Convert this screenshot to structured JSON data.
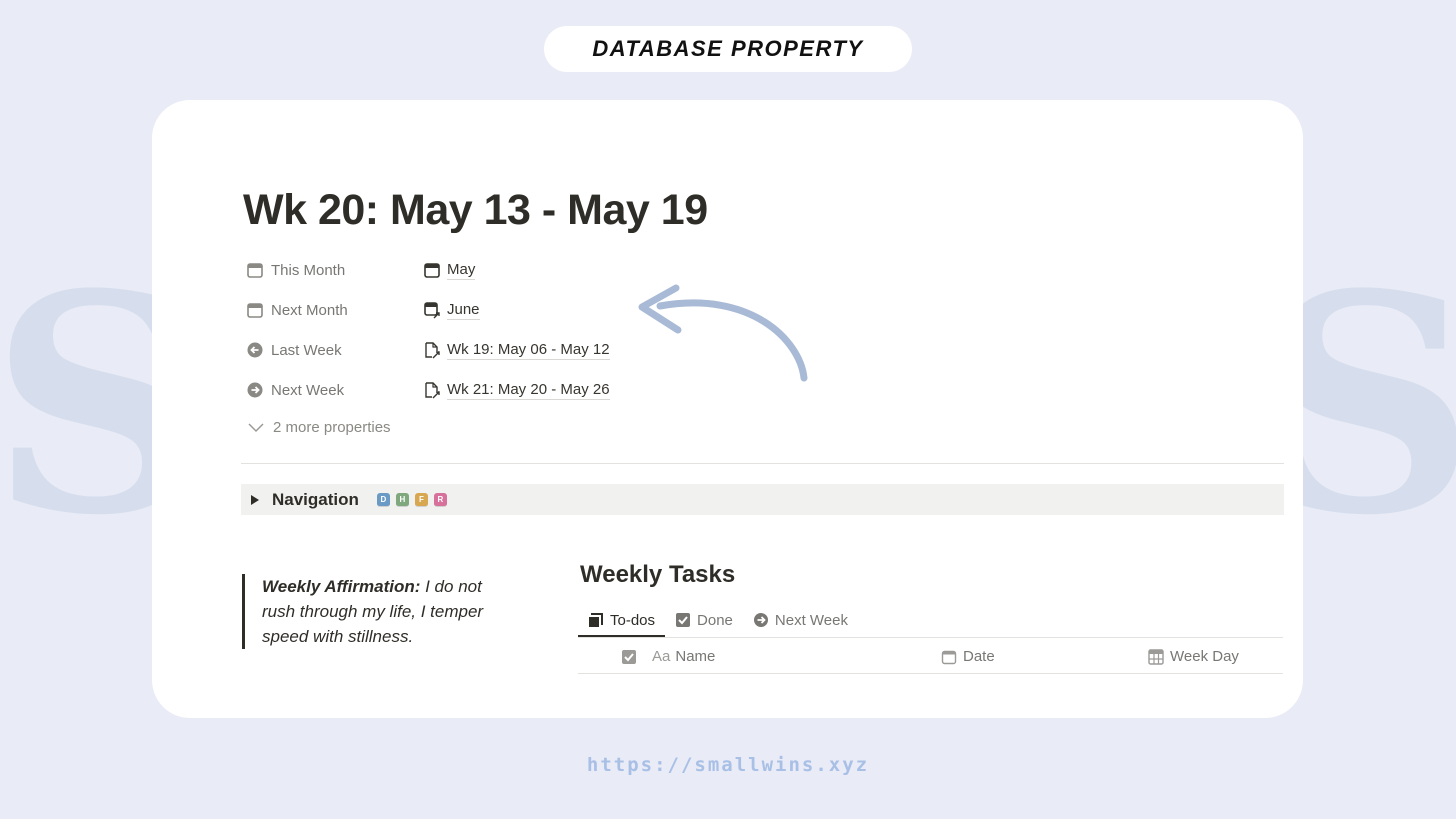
{
  "header": {
    "label": "DATABASE PROPERTY"
  },
  "watermark": {
    "left_text": "SM",
    "right_text": "NS"
  },
  "page": {
    "title": "Wk 20: May 13 - May 19",
    "properties": [
      {
        "name": "This Month",
        "name_icon": "calendar-icon",
        "value": "May",
        "value_icon": "calendar-icon"
      },
      {
        "name": "Next Month",
        "name_icon": "calendar-icon",
        "value": "June",
        "value_icon": "calendar-arrow-icon"
      },
      {
        "name": "Last Week",
        "name_icon": "arrow-left-circle-icon",
        "value": "Wk 19: May 06 - May 12",
        "value_icon": "page-link-icon"
      },
      {
        "name": "Next Week",
        "name_icon": "arrow-right-circle-icon",
        "value": "Wk 21: May 20 - May 26",
        "value_icon": "page-link-icon"
      }
    ],
    "more_properties": "2 more properties"
  },
  "navigation": {
    "title": "Navigation",
    "badges": [
      {
        "letter": "D",
        "color": "#6b9ac4"
      },
      {
        "letter": "H",
        "color": "#7fa87e"
      },
      {
        "letter": "F",
        "color": "#d7a84f"
      },
      {
        "letter": "R",
        "color": "#d7709a"
      }
    ]
  },
  "affirmation": {
    "label": "Weekly Affirmation:",
    "text": " I do not rush through my life, I temper speed with stillness."
  },
  "tasks": {
    "title": "Weekly Tasks",
    "tabs": [
      {
        "label": "To-dos",
        "icon": "stack-icon",
        "active": true
      },
      {
        "label": "Done",
        "icon": "checkbox-icon",
        "active": false
      },
      {
        "label": "Next Week",
        "icon": "arrow-right-circle-icon",
        "active": false
      }
    ],
    "columns": [
      {
        "label": "",
        "icon": "checkbox-icon"
      },
      {
        "label": "Name",
        "prefix": "Aa"
      },
      {
        "label": "Date",
        "icon": "calendar-icon"
      },
      {
        "label": "Week Day",
        "icon": "table-icon"
      }
    ]
  },
  "footer": {
    "url": "https://smallwins.xyz"
  },
  "colors": {
    "background": "#e9ebf6",
    "arrow": "#a9bad6",
    "url": "#a9c0e6"
  }
}
